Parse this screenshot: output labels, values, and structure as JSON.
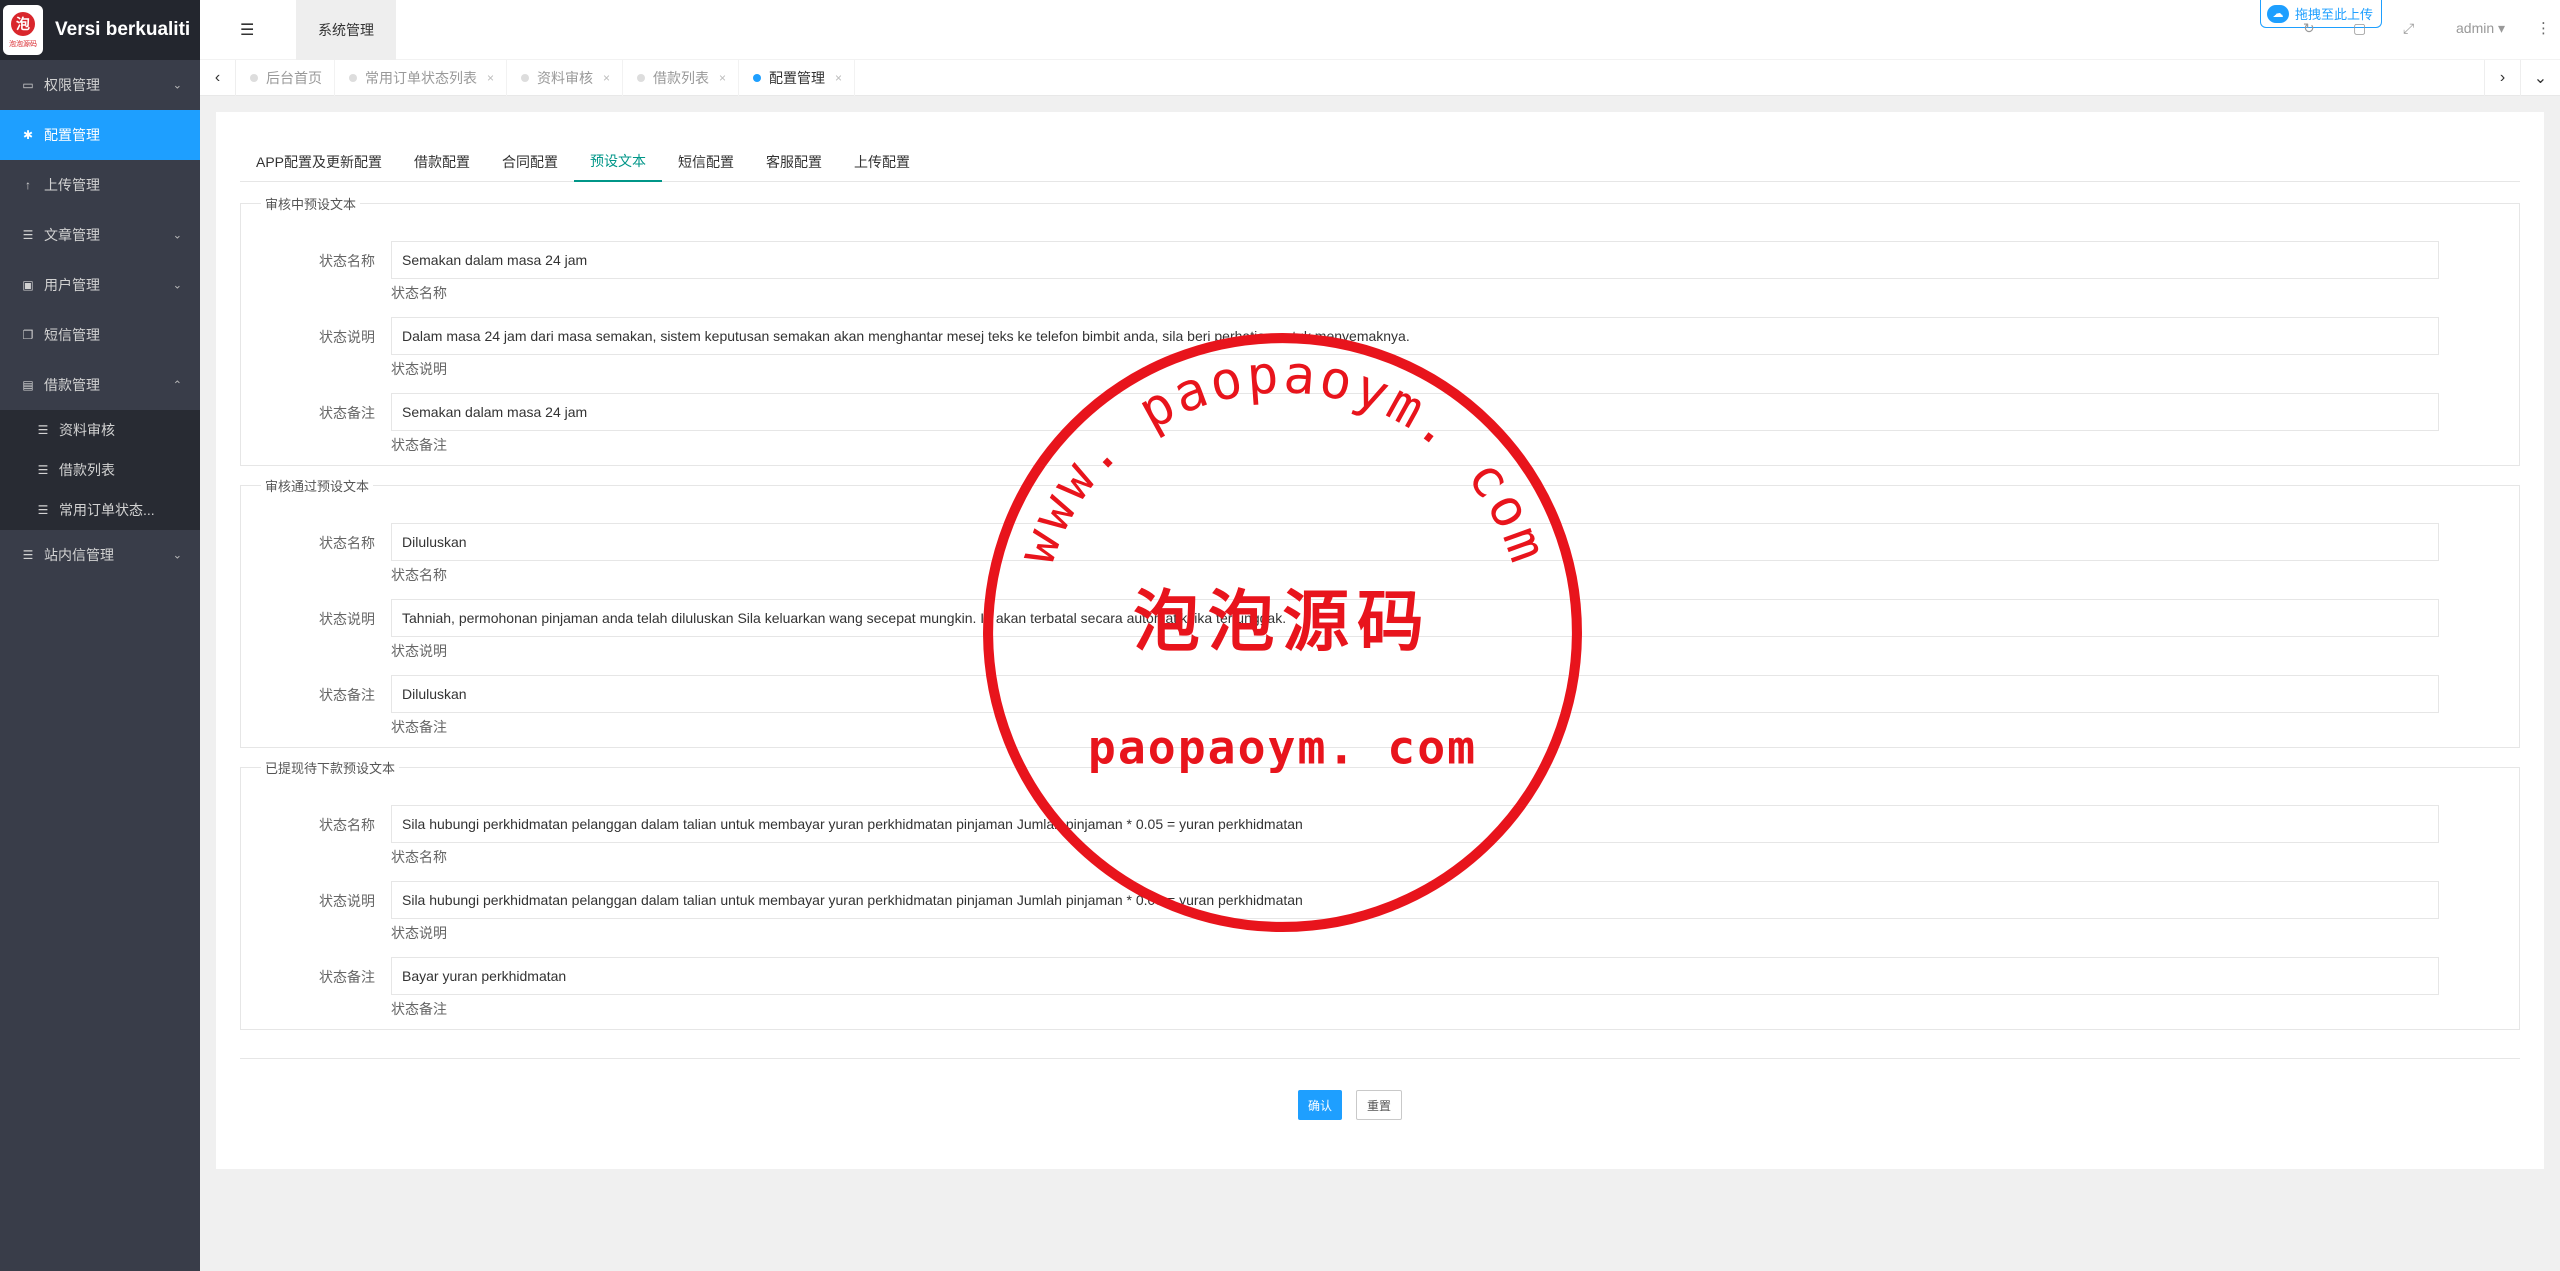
{
  "app": {
    "title": "Versi berkualiti",
    "logo_mark": "泡",
    "logo_text": "泡泡源码"
  },
  "sidebar": {
    "items": [
      {
        "label": "权限管理",
        "icon": "laptop-icon",
        "glyph": "▭",
        "expandable": true
      },
      {
        "label": "配置管理",
        "icon": "gear-icon",
        "glyph": "✱",
        "active": true
      },
      {
        "label": "上传管理",
        "icon": "upload-arrow-icon",
        "glyph": "↑"
      },
      {
        "label": "文章管理",
        "icon": "list-icon",
        "glyph": "☰",
        "expandable": true
      },
      {
        "label": "用户管理",
        "icon": "user-icon",
        "glyph": "▣",
        "expandable": true
      },
      {
        "label": "短信管理",
        "icon": "copy-icon",
        "glyph": "❐"
      },
      {
        "label": "借款管理",
        "icon": "money-icon",
        "glyph": "▤",
        "expanded": true
      }
    ],
    "sub_items": [
      {
        "label": "资料审核",
        "icon": "list-icon",
        "glyph": "☰"
      },
      {
        "label": "借款列表",
        "icon": "list-icon",
        "glyph": "☰"
      },
      {
        "label": "常用订单状态...",
        "icon": "list-icon",
        "glyph": "☰"
      }
    ],
    "last_item": {
      "label": "站内信管理",
      "icon": "list-icon",
      "glyph": "☰",
      "expandable": true
    },
    "chevron_down": "⌄",
    "chevron_up": "⌃"
  },
  "topbar": {
    "menu_toggle_glyph": "☰",
    "system_tab": "系统管理",
    "upload_label": "拖拽至此上传",
    "refresh_glyph": "↻",
    "lock_glyph": "▢",
    "fullscreen_glyph": "⤢",
    "user": "admin ▾",
    "more_glyph": "⋮"
  },
  "tabstrip": {
    "prev_glyph": "‹",
    "next_glyph": "›",
    "down_glyph": "⌄",
    "tabs": [
      {
        "label": "后台首页",
        "closable": false
      },
      {
        "label": "常用订单状态列表",
        "closable": true
      },
      {
        "label": "资料审核",
        "closable": true
      },
      {
        "label": "借款列表",
        "closable": true
      },
      {
        "label": "配置管理",
        "closable": true,
        "active": true
      }
    ],
    "close_glyph": "×"
  },
  "config_tabs": [
    {
      "label": "APP配置及更新配置"
    },
    {
      "label": "借款配置"
    },
    {
      "label": "合同配置"
    },
    {
      "label": "预设文本",
      "active": true
    },
    {
      "label": "短信配置"
    },
    {
      "label": "客服配置"
    },
    {
      "label": "上传配置"
    }
  ],
  "groups": [
    {
      "legend": "审核中预设文本",
      "fields": [
        {
          "label": "状态名称",
          "value": "Semakan dalam masa 24 jam",
          "aux": "状态名称"
        },
        {
          "label": "状态说明",
          "value": "Dalam masa 24 jam dari masa semakan, sistem keputusan semakan akan menghantar mesej teks ke telefon bimbit anda, sila beri perhatian untuk menyemaknya.",
          "aux": "状态说明"
        },
        {
          "label": "状态备注",
          "value": "Semakan dalam masa 24 jam",
          "aux": "状态备注"
        }
      ]
    },
    {
      "legend": "审核通过预设文本",
      "fields": [
        {
          "label": "状态名称",
          "value": "Diluluskan",
          "aux": "状态名称"
        },
        {
          "label": "状态说明",
          "value": "Tahniah, permohonan pinjaman anda telah diluluskan Sila keluarkan wang secepat mungkin. Ia akan terbatal secara automatik jika tertunggak.",
          "aux": "状态说明"
        },
        {
          "label": "状态备注",
          "value": "Diluluskan",
          "aux": "状态备注"
        }
      ]
    },
    {
      "legend": "已提现待下款预设文本",
      "fields": [
        {
          "label": "状态名称",
          "value": "Sila hubungi perkhidmatan pelanggan dalam talian untuk membayar yuran perkhidmatan pinjaman Jumlah pinjaman * 0.05 = yuran perkhidmatan",
          "aux": "状态名称"
        },
        {
          "label": "状态说明",
          "value": "Sila hubungi perkhidmatan pelanggan dalam talian untuk membayar yuran perkhidmatan pinjaman Jumlah pinjaman * 0.05 = yuran perkhidmatan",
          "aux": "状态说明"
        },
        {
          "label": "状态备注",
          "value": "Bayar yuran perkhidmatan",
          "aux": "状态备注"
        }
      ]
    }
  ],
  "buttons": {
    "confirm": "确认",
    "reset": "重置"
  },
  "watermark": {
    "arc_text": "www. paopaoym. com",
    "center_text": "泡泡源码",
    "bottom_text": "paopaoym. com",
    "color": "#e8141c"
  },
  "colors": {
    "accent": "#1e9fff",
    "tab_active": "#009688",
    "sidebar_bg": "#393d49",
    "sidebar_dark": "#23262e"
  }
}
